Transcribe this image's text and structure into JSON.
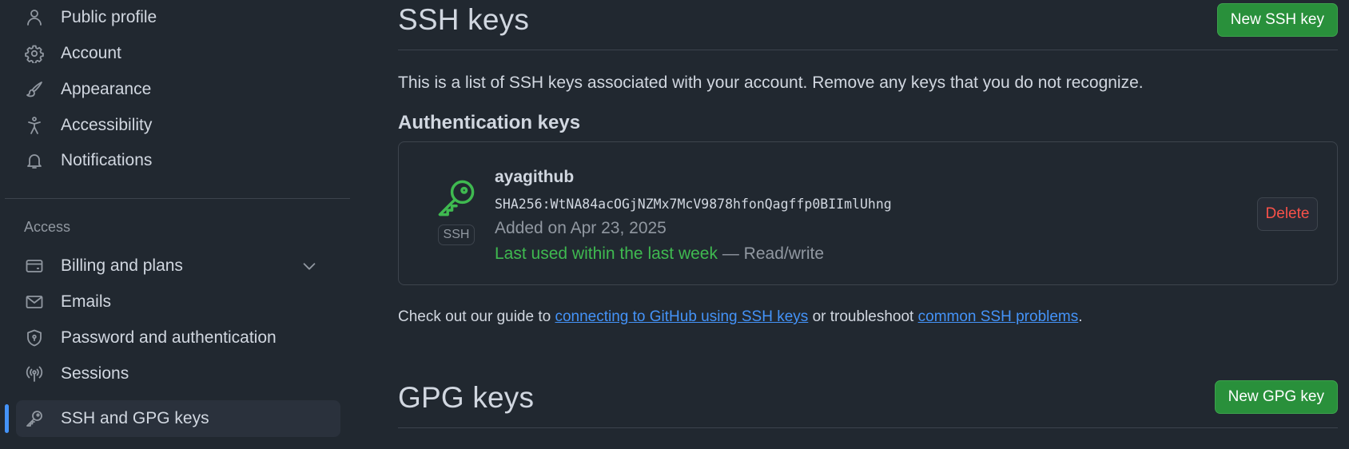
{
  "sidebar": {
    "items_top": [
      {
        "label": "Public profile",
        "icon": "person-icon"
      },
      {
        "label": "Account",
        "icon": "gear-icon"
      },
      {
        "label": "Appearance",
        "icon": "paintbrush-icon"
      },
      {
        "label": "Accessibility",
        "icon": "accessibility-icon"
      },
      {
        "label": "Notifications",
        "icon": "bell-icon"
      }
    ],
    "access_heading": "Access",
    "items_access": [
      {
        "label": "Billing and plans",
        "icon": "credit-card-icon"
      },
      {
        "label": "Emails",
        "icon": "mail-icon"
      },
      {
        "label": "Password and authentication",
        "icon": "shield-lock-icon"
      },
      {
        "label": "Sessions",
        "icon": "broadcast-icon"
      },
      {
        "label": "SSH and GPG keys",
        "icon": "key-icon"
      }
    ],
    "active_item": "SSH and GPG keys"
  },
  "ssh_section": {
    "title": "SSH keys",
    "new_button": "New SSH key",
    "description": "This is a list of SSH keys associated with your account. Remove any keys that you do not recognize.",
    "subheading": "Authentication keys",
    "key": {
      "title": "ayagithub",
      "fingerprint": "SHA256:WtNA84acOGjNZMx7McV9878hfonQagffp0BIImlUhng",
      "added": "Added on Apr 23, 2025",
      "last_used": "Last used within the last week",
      "access": "— Read/write",
      "badge": "SSH",
      "delete_label": "Delete"
    },
    "guide": {
      "prefix": "Check out our guide to ",
      "link1": "connecting to GitHub using SSH keys",
      "middle": " or troubleshoot ",
      "link2": "common SSH problems",
      "suffix": "."
    }
  },
  "gpg_section": {
    "title": "GPG keys",
    "new_button": "New GPG key"
  },
  "colors": {
    "background": "#212830",
    "accent_blue": "#4493f8",
    "success_green": "#29903b",
    "key_green": "#3fb950",
    "danger_red": "#f85149"
  }
}
